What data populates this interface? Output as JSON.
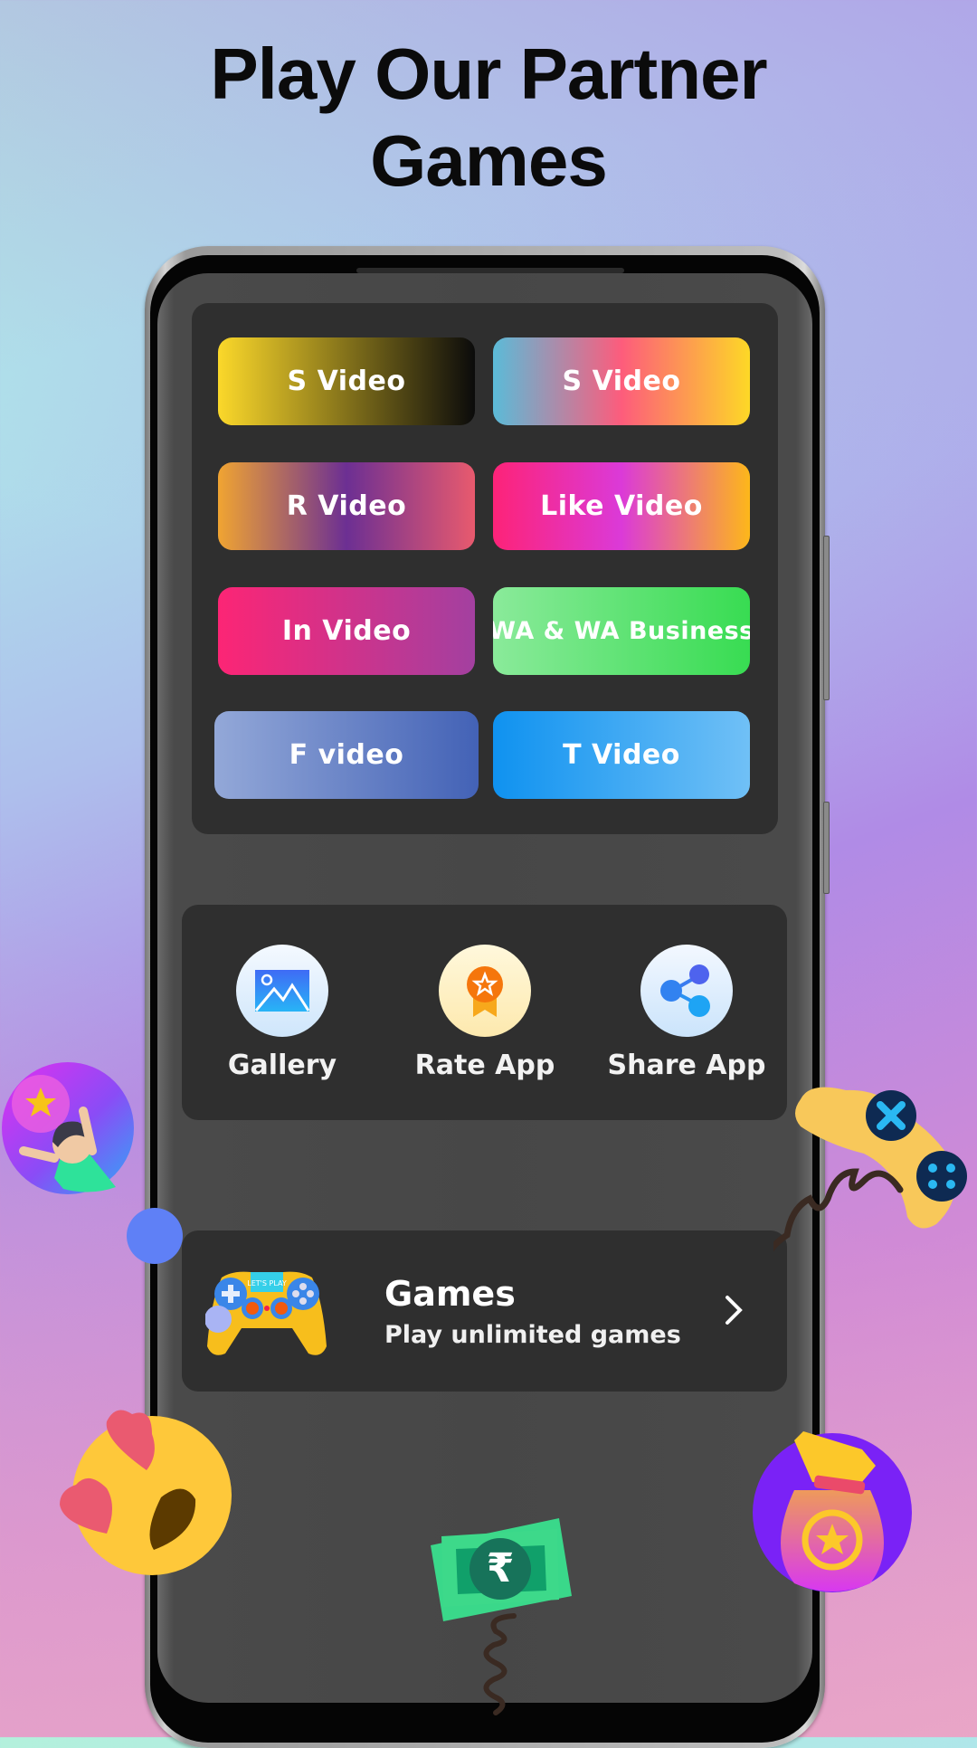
{
  "headline": {
    "line1": "Play Our Partner",
    "line2": "Games"
  },
  "video_buttons": [
    {
      "label": "S Video",
      "gradient": [
        "#fbd82a",
        "#0b0b0b"
      ]
    },
    {
      "label": "S Video",
      "gradient": [
        "#5bbbd8",
        "#fd5c7c",
        "#fdd826"
      ]
    },
    {
      "label": "R Video",
      "gradient": [
        "#f0a432",
        "#6c2f93",
        "#e85a6e"
      ]
    },
    {
      "label": "Like Video",
      "gradient": [
        "#fd2378",
        "#db3ad8",
        "#fdb71a"
      ]
    },
    {
      "label": "In Video",
      "gradient": [
        "#fc2575",
        "#a340a0"
      ]
    },
    {
      "label": "WA & WA Business",
      "gradient": [
        "#8aea9a",
        "#38dc52"
      ]
    },
    {
      "label": "F video",
      "gradient": [
        "#93a8d8",
        "#4362b6"
      ]
    },
    {
      "label": "T Video",
      "gradient": [
        "#0f92f0",
        "#70c0f6"
      ]
    }
  ],
  "actions": [
    {
      "label": "Gallery",
      "icon": "image-icon"
    },
    {
      "label": "Rate App",
      "icon": "award-star-icon"
    },
    {
      "label": "Share App",
      "icon": "share-icon"
    }
  ],
  "games_card": {
    "title": "Games",
    "subtitle": "Play unlimited games",
    "controller_text": "LET'S PLAY"
  },
  "money_symbol": "₹",
  "colors": {
    "panel": "#2f2f2f",
    "screen": "#474747",
    "text": "#ffffff"
  }
}
